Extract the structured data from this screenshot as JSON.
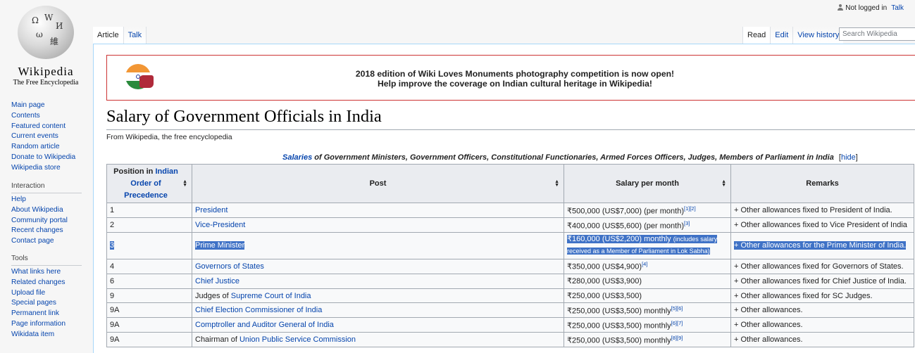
{
  "logo": {
    "wordmark": "Wikipedia",
    "tagline": "The Free Encyclopedia"
  },
  "personal": {
    "status": "Not logged in",
    "talk": "Talk"
  },
  "tabs": {
    "left": [
      {
        "label": "Article"
      },
      {
        "label": "Talk"
      }
    ],
    "right": [
      {
        "label": "Read"
      },
      {
        "label": "Edit"
      },
      {
        "label": "View history"
      }
    ],
    "search_placeholder": "Search Wikipedia"
  },
  "sidebar": {
    "nav": [
      "Main page",
      "Contents",
      "Featured content",
      "Current events",
      "Random article",
      "Donate to Wikipedia",
      "Wikipedia store"
    ],
    "interaction": {
      "heading": "Interaction",
      "items": [
        "Help",
        "About Wikipedia",
        "Community portal",
        "Recent changes",
        "Contact page"
      ]
    },
    "tools": {
      "heading": "Tools",
      "items": [
        "What links here",
        "Related changes",
        "Upload file",
        "Special pages",
        "Permanent link",
        "Page information",
        "Wikidata item"
      ]
    }
  },
  "banner": {
    "line1": "2018 edition of Wiki Loves Monuments photography competition is now open!",
    "line2": "Help improve the coverage on Indian cultural heritage in Wikipedia!"
  },
  "page": {
    "title": "Salary of Government Officials in India",
    "tagline": "From Wikipedia, the free encyclopedia"
  },
  "table": {
    "caption_link": "Salaries",
    "caption_rest": " of Government Ministers, Government Officers, Constitutional Functionaries, Armed Forces Officers, Judges, Members of Parliament in India",
    "hide": "[hide]",
    "headers": {
      "position_line1": "Position in",
      "position_link1": "Indian",
      "position_link2": "Order of",
      "position_link3": "Precedence",
      "post": "Post",
      "salary": "Salary per month",
      "remarks": "Remarks"
    },
    "rows": [
      {
        "pos": "1",
        "post": "President",
        "salary": "₹500,000 (US$7,000) (per month)",
        "refs": "[1][2]",
        "remarks": "+ Other allowances fixed to President of India."
      },
      {
        "pos": "2",
        "post": "Vice-President",
        "salary": "₹400,000 (US$5,600) (per month)",
        "refs": "[3]",
        "remarks": "+ Other allowances fixed to Vice President of India"
      },
      {
        "pos": "3",
        "post": "Prime Minister",
        "salary": "₹160,000 (US$2,200) monthly",
        "salary_note": "(includes salary",
        "salary_note2": "received as a Member of Parliament in Lok Sabha)",
        "refs": "",
        "remarks": "+ Other allowances for the Prime Minister of India."
      },
      {
        "pos": "4",
        "post": "Governors of States",
        "salary": "₹350,000 (US$4,900)",
        "refs": "[4]",
        "remarks": "+ Other allowances fixed for Governors of States."
      },
      {
        "pos": "6",
        "post": "Chief Justice",
        "salary": "₹280,000 (US$3,900)",
        "refs": "",
        "remarks": "+ Other allowances fixed for Chief Justice of India."
      },
      {
        "pos": "9",
        "post_prefix": "Judges of ",
        "post": "Supreme Court of India",
        "salary": "₹250,000 (US$3,500)",
        "refs": "",
        "remarks": "+ Other allowances fixed for SC Judges."
      },
      {
        "pos": "9A",
        "post": "Chief Election Commissioner of India",
        "salary": "₹250,000 (US$3,500) monthly",
        "refs": "[5][6]",
        "remarks": "+ Other allowances."
      },
      {
        "pos": "9A",
        "post": "Comptroller and Auditor General of India",
        "salary": "₹250,000 (US$3,500) monthly",
        "refs": "[6][7]",
        "remarks": "+ Other allowances."
      },
      {
        "pos": "9A",
        "post_prefix": "Chairman of ",
        "post": "Union Public Service Commission",
        "salary": "₹250,000 (US$3,500) monthly",
        "refs": "[8][9]",
        "remarks": "+ Other allowances."
      }
    ]
  }
}
